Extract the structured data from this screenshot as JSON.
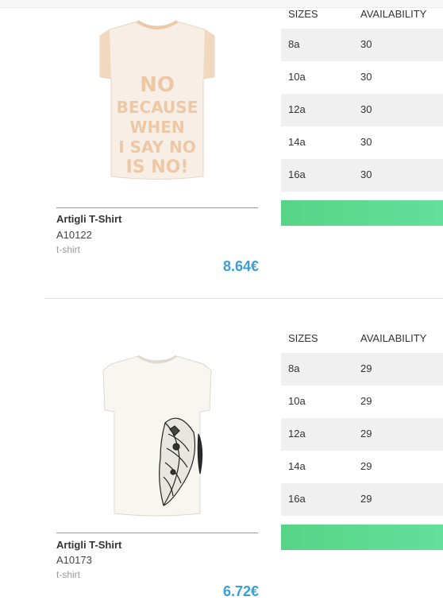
{
  "table_headers": {
    "sizes": "SIZES",
    "availability": "AVAILABILITY"
  },
  "products": [
    {
      "name": "Artigli T-Shirt",
      "code": "A10122",
      "category": "t-shirt",
      "price": "8.64€",
      "print_text": "NO BECAUSE WHEN I SAY NO IS NO!",
      "sizes": [
        {
          "size": "8a",
          "availability": "30"
        },
        {
          "size": "10a",
          "availability": "30"
        },
        {
          "size": "12a",
          "availability": "30"
        },
        {
          "size": "14a",
          "availability": "30"
        },
        {
          "size": "16a",
          "availability": "30"
        }
      ]
    },
    {
      "name": "Artigli T-Shirt",
      "code": "A10173",
      "category": "t-shirt",
      "price": "6.72€",
      "sizes": [
        {
          "size": "8a",
          "availability": "29"
        },
        {
          "size": "10a",
          "availability": "29"
        },
        {
          "size": "12a",
          "availability": "29"
        },
        {
          "size": "14a",
          "availability": "29"
        },
        {
          "size": "16a",
          "availability": "29"
        }
      ]
    }
  ],
  "colors": {
    "price": "#3a9ed4",
    "cta_green": "#5cd98f",
    "row_stripe": "#f0f0f0"
  }
}
